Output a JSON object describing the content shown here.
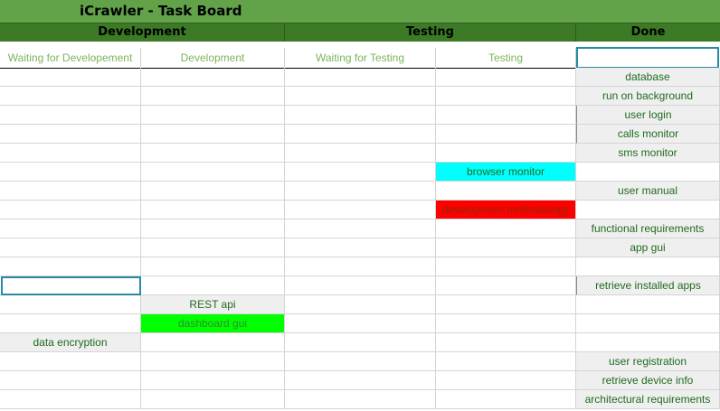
{
  "title": "iCrawler - Task Board",
  "groups": {
    "development": "Development",
    "testing": "Testing",
    "done": "Done"
  },
  "columns": [
    "Waiting for Developement",
    "Development",
    "Waiting for Testing",
    "Testing",
    ""
  ],
  "cards": {
    "database": "database",
    "run_on_background": "run on background",
    "user_login": "user login",
    "calls_monitor": "calls monitor",
    "sms_monitor": "sms monitor",
    "browser_monitor": "browser monitor",
    "user_manual": "user manual",
    "development_methodology": "development methodology",
    "functional_requirements": "functional requirements",
    "app_gui": "app gui",
    "retrieve_installed_apps": "retrieve installed apps",
    "rest_api": "REST api",
    "dashboard_gui": "dashboard gui",
    "data_encryption": "data encryption",
    "user_registration": "user registration",
    "retrieve_device_info": "retrieve device info",
    "architectural_requirements": "architectural requirements"
  },
  "colors": {
    "cyan": "#00ffff",
    "red": "#ff0000",
    "green": "#00ff00",
    "header_green": "#62a34a",
    "group_green": "#3c7a26"
  }
}
